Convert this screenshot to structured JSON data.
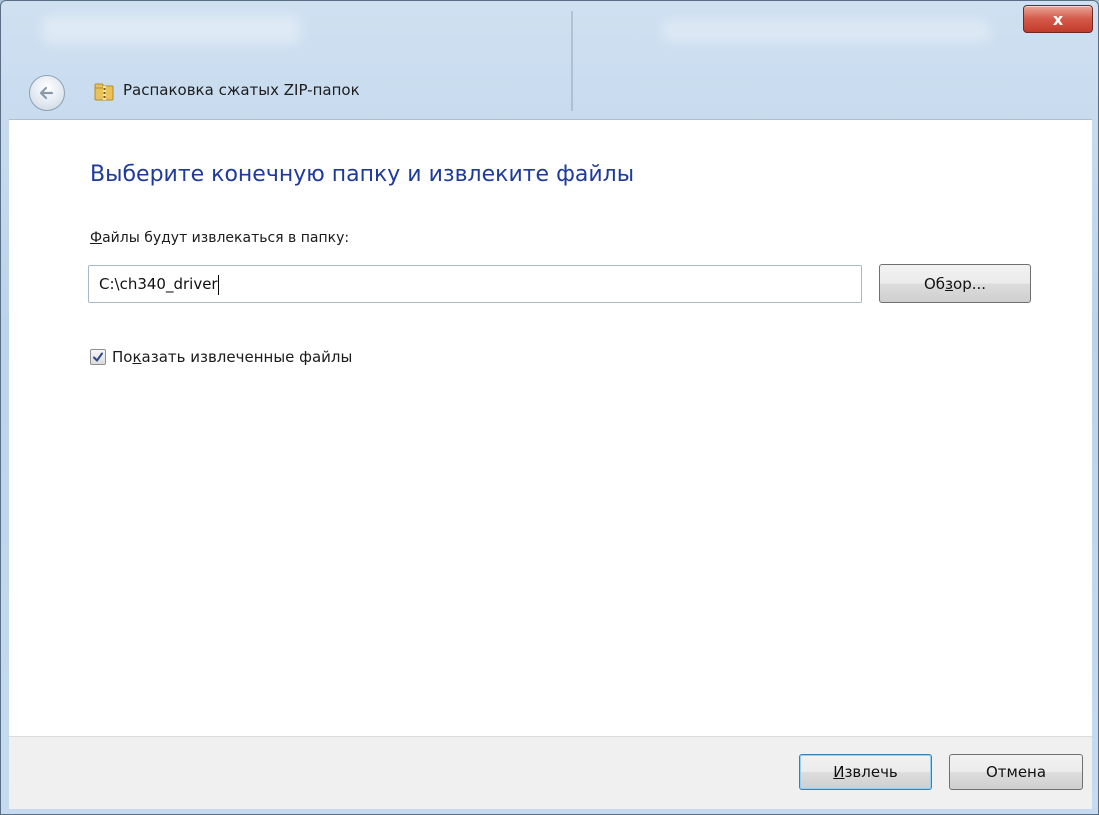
{
  "window": {
    "close_label": "x"
  },
  "nav": {
    "title": "Распаковка сжатых ZIP-папок",
    "back_icon": "back-arrow-icon",
    "folder_icon": "zip-folder-icon"
  },
  "main": {
    "heading": "Выберите конечную папку и извлеките файлы",
    "path_label_prefix": "Ф",
    "path_label_rest": "айлы будут извлекаться в папку:",
    "path_value": "C:\\ch340_driver",
    "browse": {
      "pre": "Об",
      "ul": "з",
      "post": "ор..."
    },
    "show_files": {
      "pre": "По",
      "ul": "к",
      "post": "азать извлеченные файлы",
      "checked": true
    }
  },
  "footer": {
    "extract": {
      "ul": "И",
      "post": "звлечь"
    },
    "cancel_label": "Отмена"
  },
  "colors": {
    "heading": "#1e3a9a",
    "close_button": "#c13b2a",
    "default_button_border": "#3c7fb1"
  }
}
